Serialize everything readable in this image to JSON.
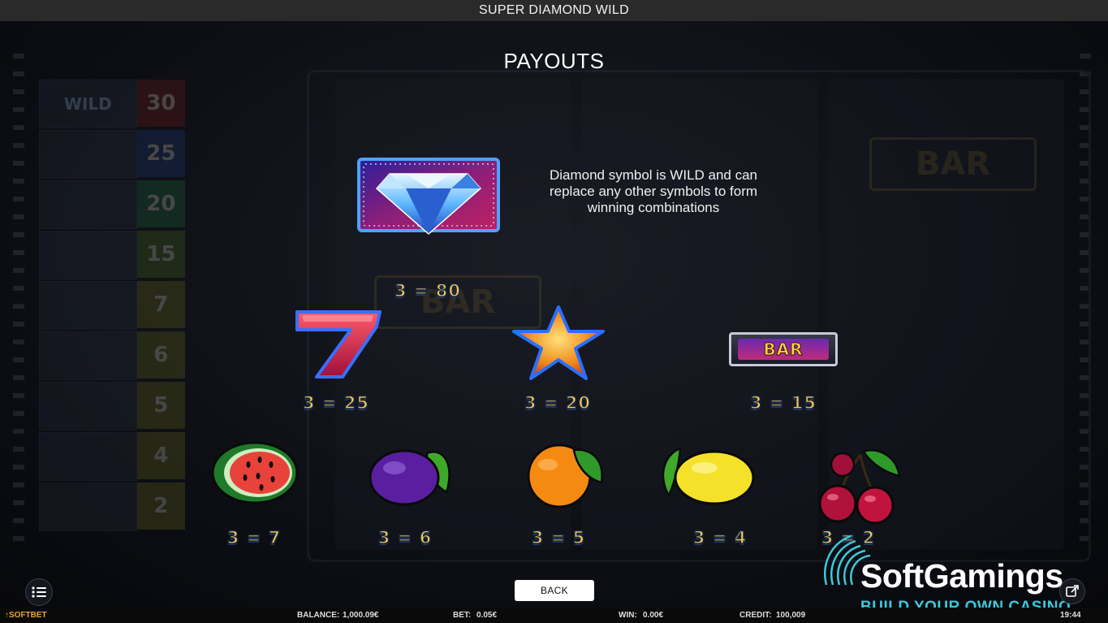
{
  "window": {
    "title": "SUPER DIAMOND WILD"
  },
  "screen": {
    "title": "PAYOUTS",
    "wild_description": "Diamond symbol is WILD and can replace any other symbols to form winning combinations",
    "payouts": {
      "diamond": "3 = 80",
      "seven": "3 = 25",
      "star": "3 = 20",
      "bar": "3 = 15",
      "watermelon": "3 = 7",
      "plum": "3 = 6",
      "orange": "3 = 5",
      "lemon": "3 = 4",
      "cherry": "3 = 2"
    },
    "bar_symbol_text": "BAR",
    "back_label": "BACK"
  },
  "background": {
    "paytable_values": [
      "30",
      "25",
      "20",
      "15",
      "7",
      "6",
      "5",
      "4",
      "2"
    ],
    "paytable_wild_label": "WILD",
    "reel_bar_text": "BAR"
  },
  "status_bar": {
    "brand": "↑SOFTBET",
    "balance_label": "BALANCE:",
    "balance_value": "1,000.09€",
    "bet_label": "BET:",
    "bet_value": "0.05€",
    "win_label": "WIN:",
    "win_value": "0.00€",
    "credit_label": "CREDIT:",
    "credit_value": "100,009",
    "time": "19:44"
  },
  "watermark": {
    "name": "SoftGamings",
    "tagline": "BUILD YOUR OWN CASINO"
  },
  "colors": {
    "payout_text": "#f4c95a",
    "watermark_accent": "#3dc8d9",
    "titlebar": "#2a2a2a"
  }
}
